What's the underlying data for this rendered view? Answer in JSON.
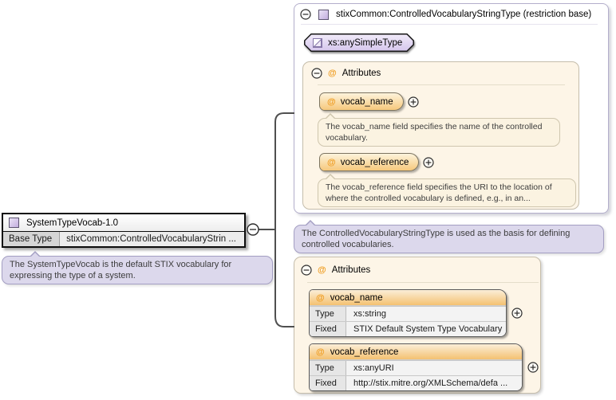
{
  "colors": {
    "accent_orange": "#ef9c1f",
    "tag_orange_gradient_bottom": "#f6c87c",
    "cream_panel": "#fdf5e7",
    "purple_tooltip": "#dcd8ec",
    "purple_type_icon": "#c3aede",
    "panel_border": "#b3aecb",
    "connector": "#4f4f4f"
  },
  "icons": {
    "at": "@",
    "collapse": "−",
    "expand": "+"
  },
  "element_box": {
    "title": "SystemTypeVocab-1.0",
    "rows": [
      {
        "label": "Base Type",
        "value": "stixCommon:ControlledVocabularyStrin ..."
      }
    ],
    "annotation": "The SystemTypeVocab is the default STIX vocabulary for expressing the type of a system."
  },
  "base_type_panel": {
    "title": "stixCommon:ControlledVocabularyStringType (restriction base)",
    "badge": "xs:anySimpleType",
    "attributes_section": {
      "title": "Attributes",
      "items": [
        {
          "name": "vocab_name",
          "annotation": "The vocab_name field specifies the name of the controlled vocabulary."
        },
        {
          "name": "vocab_reference",
          "annotation": "The vocab_reference field specifies the URI to the location of where the controlled vocabulary is defined, e.g., in an..."
        }
      ]
    },
    "annotation": "The ControlledVocabularyStringType is used as the basis for defining controlled vocabularies."
  },
  "attributes_panel": {
    "title": "Attributes",
    "tables": [
      {
        "name": "vocab_name",
        "rows": [
          {
            "label": "Type",
            "value": "xs:string"
          },
          {
            "label": "Fixed",
            "value": "STIX Default System Type Vocabulary"
          }
        ]
      },
      {
        "name": "vocab_reference",
        "rows": [
          {
            "label": "Type",
            "value": "xs:anyURI"
          },
          {
            "label": "Fixed",
            "value": "http://stix.mitre.org/XMLSchema/defa ..."
          }
        ]
      }
    ]
  }
}
